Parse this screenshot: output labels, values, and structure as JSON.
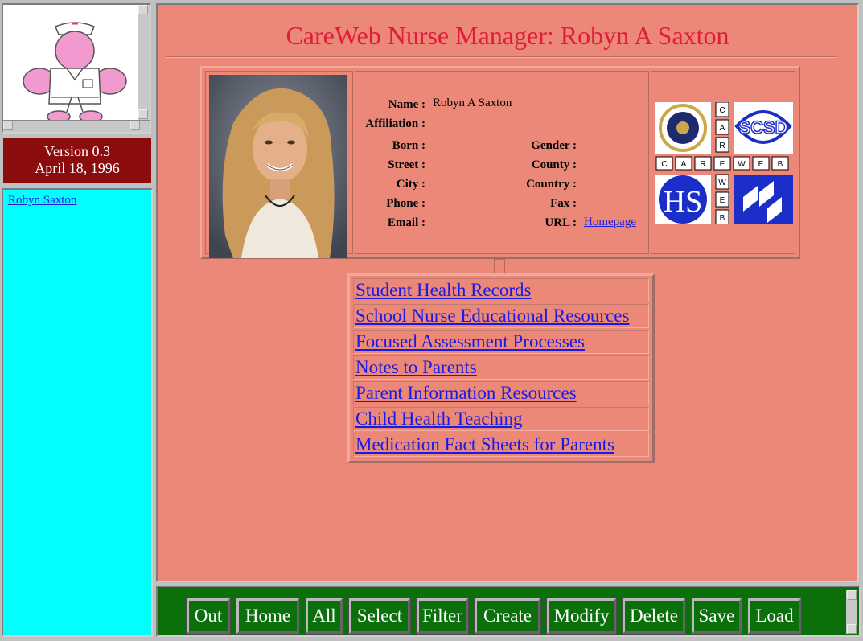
{
  "sidebar": {
    "version": "Version 0.3",
    "date": "April 18, 1996",
    "nurse_link": "Robyn Saxton"
  },
  "main": {
    "title": "CareWeb Nurse Manager: Robyn A Saxton",
    "profile": {
      "name_label": "Name :",
      "name_value": "Robyn A Saxton",
      "affiliation_label": "Affiliation :",
      "born_label": "Born :",
      "gender_label": "Gender :",
      "street_label": "Street :",
      "county_label": "County :",
      "city_label": "City :",
      "country_label": "Country :",
      "phone_label": "Phone :",
      "fax_label": "Fax :",
      "email_label": "Email :",
      "url_label": "URL :",
      "url_link": "Homepage"
    },
    "logos": {
      "careweb_vertical": [
        "C",
        "A",
        "R",
        "E",
        "W",
        "E",
        "B"
      ],
      "careweb_horizontal": [
        "C",
        "A",
        "R",
        "E",
        "W",
        "E",
        "B"
      ],
      "scsd_text": "SCSD"
    },
    "links": [
      "Student Health Records",
      "School Nurse Educational Resources",
      "Focused Assessment Processes",
      "Notes to Parents",
      "Parent Information Resources",
      "Child Health Teaching",
      "Medication Fact Sheets for Parents"
    ]
  },
  "toolbar": {
    "buttons": [
      "Out",
      "Home",
      "All",
      "Select",
      "Filter",
      "Create",
      "Modify",
      "Delete",
      "Save",
      "Load"
    ]
  },
  "colors": {
    "main_bg": "#ec8878",
    "title": "#e01c3c",
    "version_bg": "#8b0c0c",
    "list_bg": "#00ffff",
    "toolbar_bg": "#0b700b",
    "link": "#1a1ae6"
  }
}
